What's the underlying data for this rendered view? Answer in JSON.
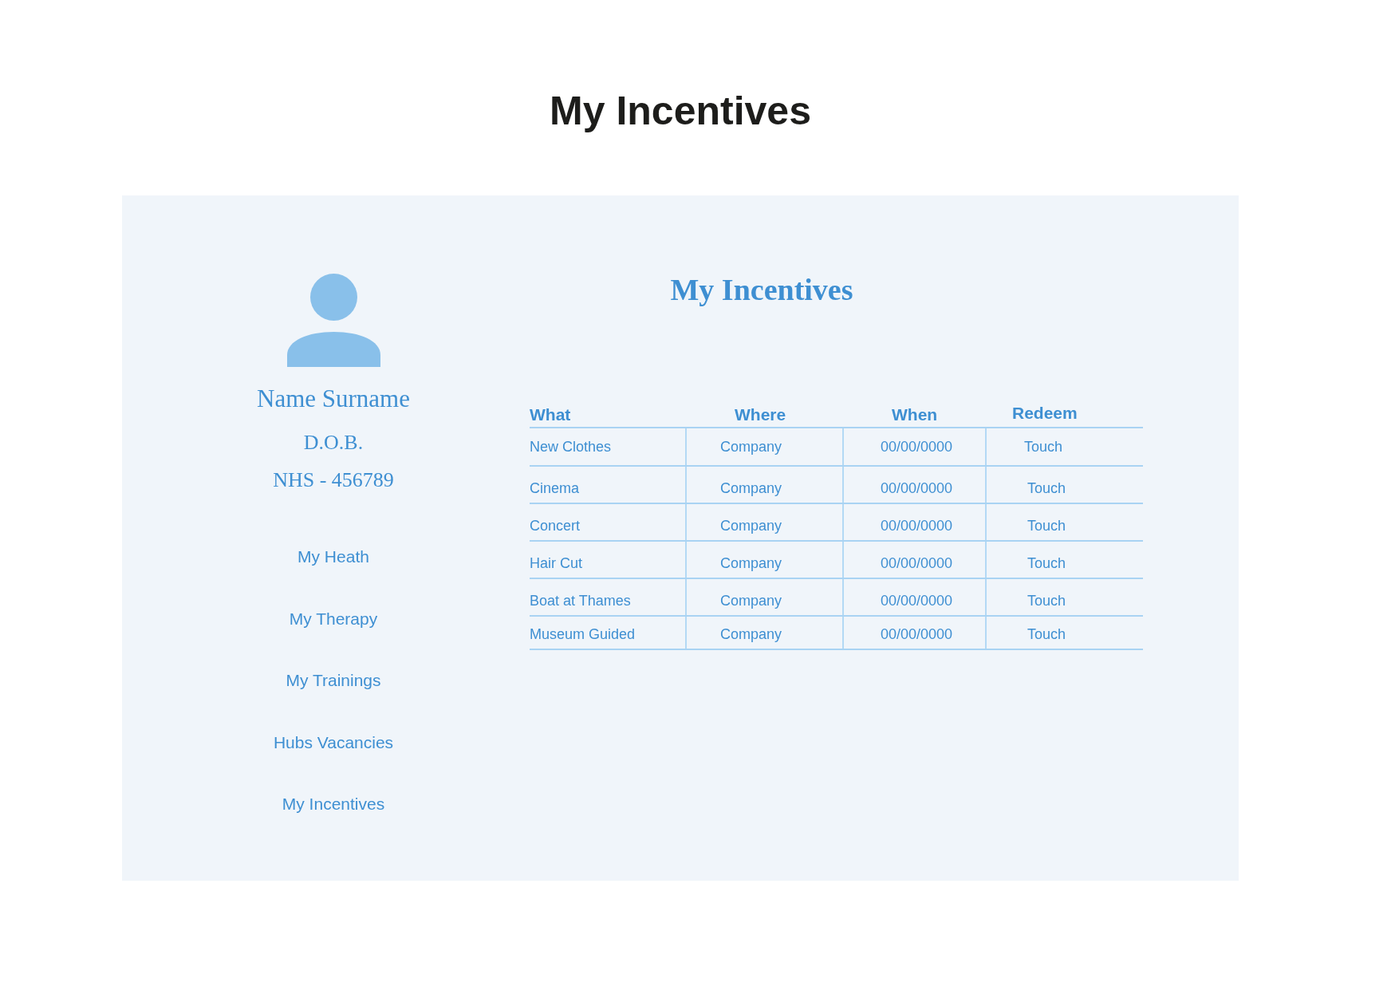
{
  "page_title": "My Incentives",
  "profile": {
    "name": "Name Surname",
    "dob": "D.O.B.",
    "nhs": "NHS - 456789"
  },
  "nav": [
    {
      "label": "My Heath"
    },
    {
      "label": "My Therapy"
    },
    {
      "label": "My Trainings"
    },
    {
      "label": "Hubs Vacancies"
    },
    {
      "label": "My Incentives"
    }
  ],
  "main": {
    "title": "My Incentives",
    "table": {
      "columns": [
        "What",
        "Where",
        "When",
        "Redeem"
      ],
      "rows": [
        [
          "New Clothes",
          "Company",
          "00/00/0000",
          "Touch"
        ],
        [
          "Cinema",
          "Company",
          "00/00/0000",
          "Touch"
        ],
        [
          "Concert",
          "Company",
          "00/00/0000",
          "Touch"
        ],
        [
          "Hair Cut",
          "Company",
          "00/00/0000",
          "Touch"
        ],
        [
          "Boat at Thames",
          "Company",
          "00/00/0000",
          "Touch"
        ],
        [
          "Museum Guided",
          "Company",
          "00/00/0000",
          "Touch"
        ]
      ]
    }
  }
}
